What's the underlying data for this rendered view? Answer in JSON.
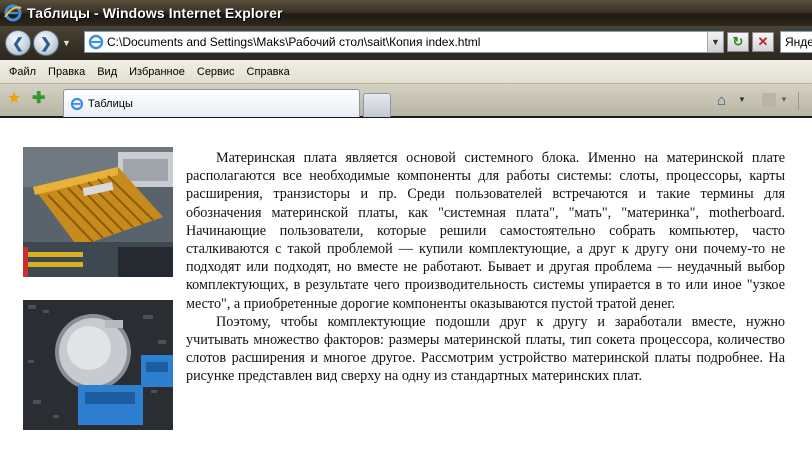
{
  "window": {
    "title": "Таблицы - Windows Internet Explorer"
  },
  "address_bar": {
    "url": "C:\\Documents and Settings\\Maks\\Рабочий стол\\sait\\Копия index.html",
    "search_text": "Янде"
  },
  "menu": {
    "items": [
      "Файл",
      "Правка",
      "Вид",
      "Избранное",
      "Сервис",
      "Справка"
    ]
  },
  "tabs": {
    "active_label": "Таблицы"
  },
  "colors": {
    "titlebar": "#3b3326",
    "page_bg": "#ffffff",
    "text": "#111111"
  },
  "icons": {
    "favorites": "favorites-star-icon",
    "add_favorites": "add-favorites-icon",
    "home": "home-icon",
    "feeds": "feeds-icon",
    "refresh": "refresh-icon",
    "stop": "stop-icon"
  },
  "article": {
    "paragraphs": [
      "Материнская плата является основой системного блока. Именно на материнской плате располагаются все необходимые компоненты для работы системы: слоты, процессоры, карты расширения, транзисторы и пр. Среди пользователей встречаются и такие термины для обозначения материнской платы, как \"системная плата\", \"мать\", \"материнка\", motherboard. Начинающие пользователи, которые решили самостоятельно собрать компьютер, часто сталкиваются с такой проблемой — купили комплектующие, а друг к другу они почему-то не подходят или подходят, но вместе не работают. Бывает и другая проблема — неудачный выбор комплектующих, в результате чего производительность системы упирается в то или иное \"узкое место\", а приобретенные дорогие компоненты оказываются пустой тратой денег.",
      "Поэтому, чтобы комплектующие подошли друг к другу и заработали вместе, нужно учитывать множество факторов: размеры материнской платы, тип сокета процессора, количество слотов расширения и многое другое. Рассмотрим устройство материнской платы подробнее. На рисунке представлен вид сверху на одну из стандартных материнских плат."
    ]
  }
}
